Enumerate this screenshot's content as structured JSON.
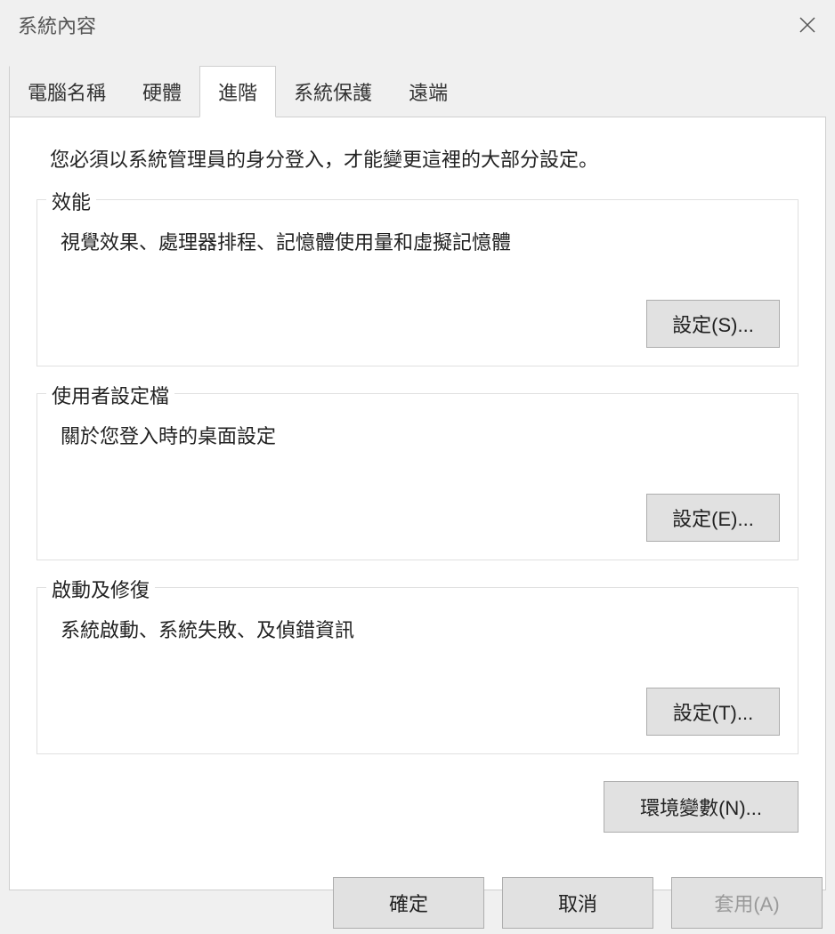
{
  "window": {
    "title": "系統內容"
  },
  "tabs": [
    {
      "label": "電腦名稱"
    },
    {
      "label": "硬體"
    },
    {
      "label": "進階"
    },
    {
      "label": "系統保護"
    },
    {
      "label": "遠端"
    }
  ],
  "panel": {
    "description": "您必須以系統管理員的身分登入，才能變更這裡的大部分設定。",
    "groups": [
      {
        "title": "效能",
        "desc": "視覺效果、處理器排程、記憶體使用量和虛擬記憶體",
        "button": "設定(S)..."
      },
      {
        "title": "使用者設定檔",
        "desc": "關於您登入時的桌面設定",
        "button": "設定(E)..."
      },
      {
        "title": "啟動及修復",
        "desc": "系統啟動、系統失敗、及偵錯資訊",
        "button": "設定(T)..."
      }
    ],
    "env_button": "環境變數(N)..."
  },
  "footer": {
    "ok": "確定",
    "cancel": "取消",
    "apply": "套用(A)"
  }
}
